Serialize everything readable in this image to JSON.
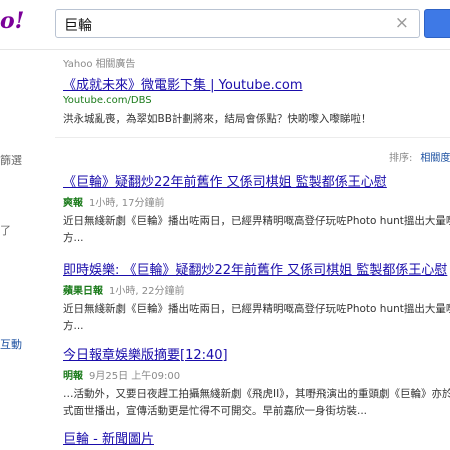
{
  "sidebar": {
    "logo_fragment": "o!",
    "item1": "篩選",
    "item2": "了",
    "item3": "互動"
  },
  "search": {
    "query": "巨輪",
    "clear_glyph": "×"
  },
  "ad": {
    "label": "Yahoo",
    "sponsor": "相關廣告",
    "title": "《成就未來》微電影下集 | Youtube.com",
    "url": "Youtube.com/DBS",
    "desc": "洪永城亂喪，為翠如BB計劃將來，結局會係點？快啲嚟入嚟睇啦！"
  },
  "sort": {
    "label": "排序:",
    "value": "相關度"
  },
  "results": [
    {
      "title": "《巨輪》疑翻炒22年前舊作 又係司棋姐 監製都係王心慰",
      "source": "爽報",
      "time": "1小時, 17分鐘前",
      "snippet1": "近日無綫新劇《巨輪》播出咗兩日，已經畀精明嘅高登仔玩咗Photo hunt搵出大量嘢合",
      "snippet2": "方..."
    },
    {
      "title": "即時娛樂: 《巨輪》疑翻炒22年前舊作 又係司棋姐 監製都係王心慰",
      "source": "蘋果日報",
      "time": "1小時, 22分鐘前",
      "snippet1": "近日無綫新劇《巨輪》播出咗兩日，已經畀精明嘅高登仔玩咗Photo hunt搵出大量嘢合",
      "snippet2": "方..."
    },
    {
      "title": "今日報章娛樂版摘要[12:40]",
      "source": "明報",
      "time": "9月25日 上午09:00",
      "snippet1": "…活動外，又要日夜趕工拍攝無綫新劇《飛虎II》，其嘢飛演出的重頭劇《巨輪》亦於",
      "snippet2": "式面世播出，宣傳活動更是忙得不可開交。早前嘉欣一身街坊裝..."
    },
    {
      "title": "巨輪 - 新聞圖片"
    }
  ]
}
